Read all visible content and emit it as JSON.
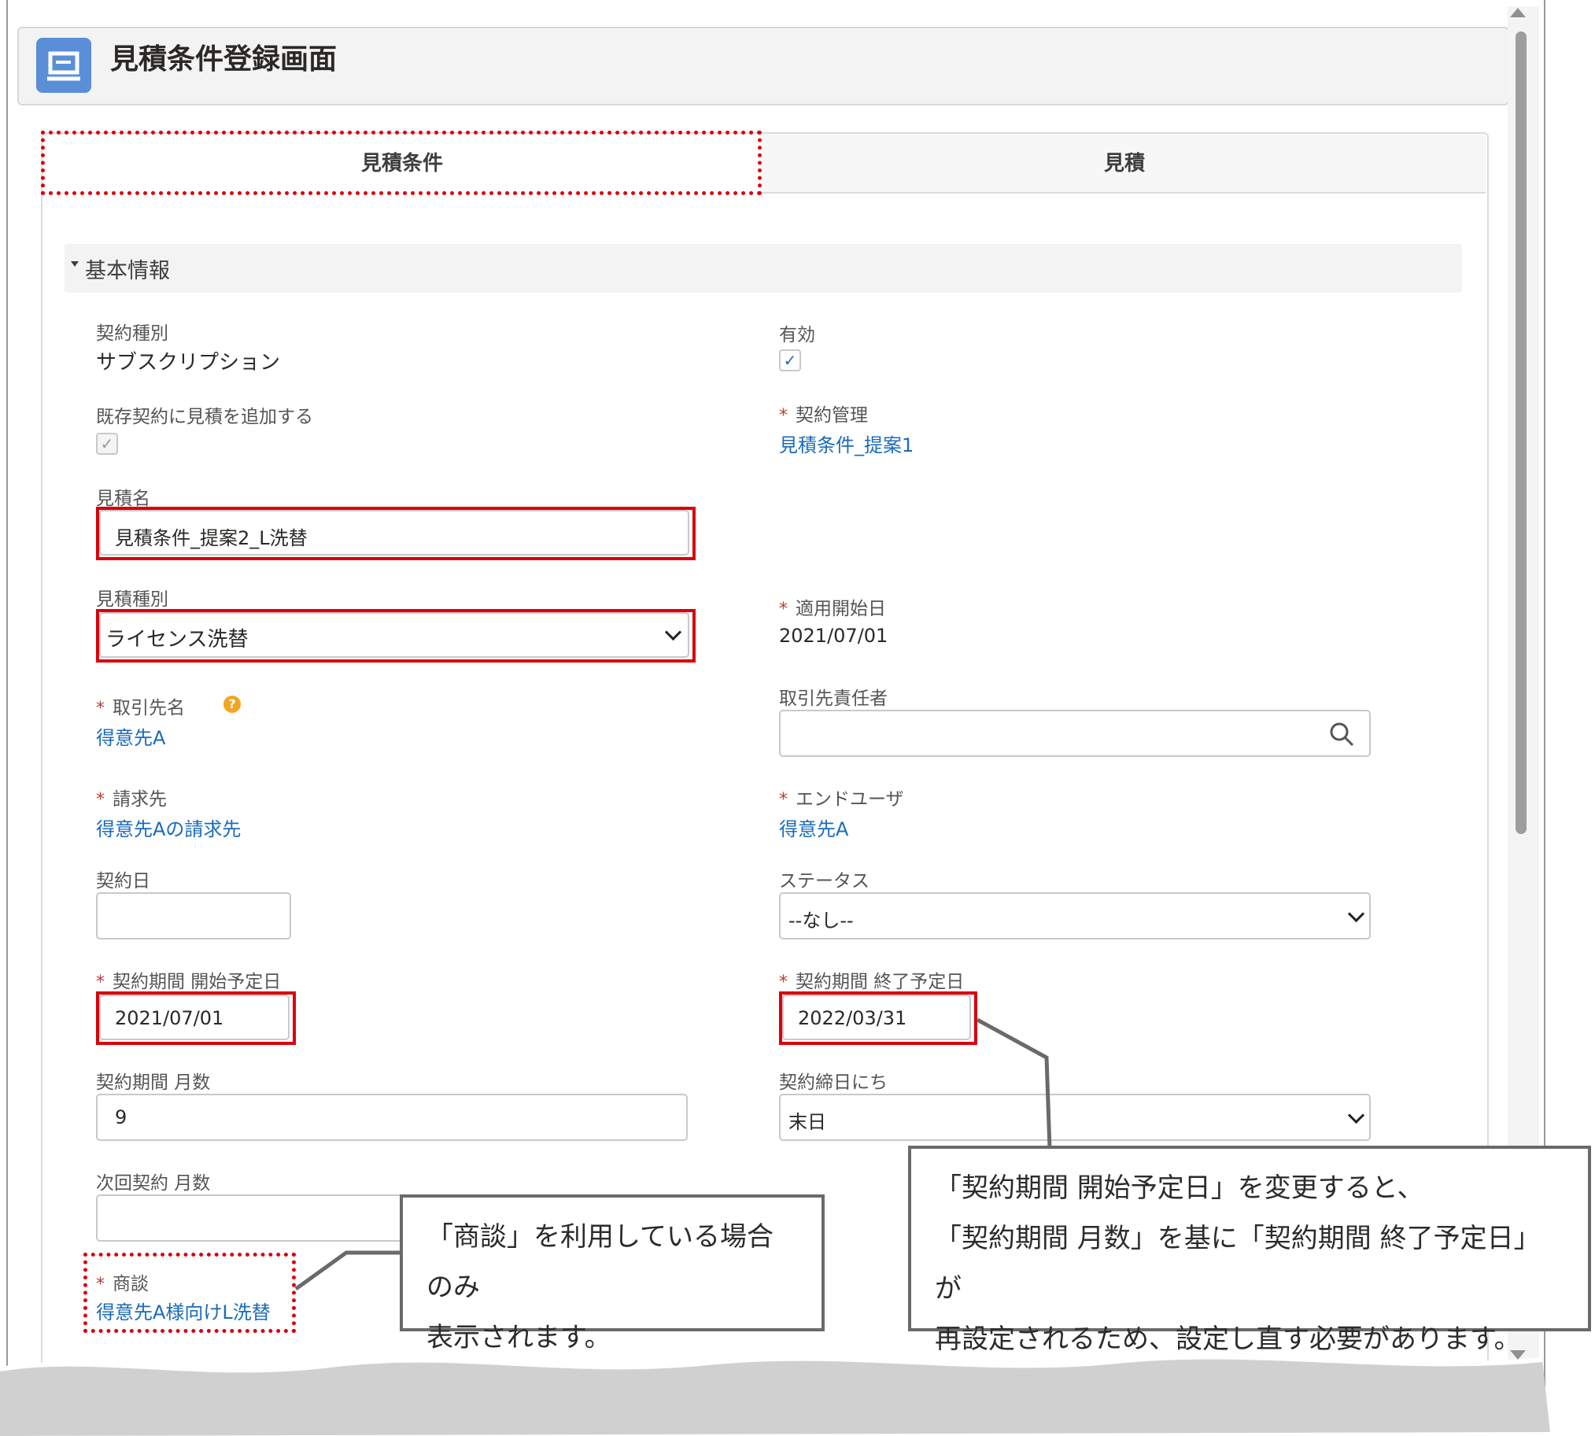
{
  "header": {
    "title": "見積条件登録画面",
    "icon": "record-icon"
  },
  "tabs": [
    {
      "label": "見積条件",
      "selected": true
    },
    {
      "label": "見積",
      "selected": false
    }
  ],
  "section": {
    "title": "基本情報"
  },
  "fields": {
    "contract_type": {
      "label": "契約種別",
      "value": "サブスクリプション"
    },
    "active": {
      "label": "有効",
      "checked": true
    },
    "add_to_existing": {
      "label": "既存契約に見積を追加する",
      "checked": true
    },
    "contract_mgmt": {
      "label": "契約管理",
      "value": "見積条件_提案1"
    },
    "quote_name": {
      "label": "見積名",
      "value": "見積条件_提案2_L洗替"
    },
    "quote_type": {
      "label": "見積種別",
      "value": "ライセンス洗替"
    },
    "apply_start": {
      "label": "適用開始日",
      "value": "2021/07/01"
    },
    "account": {
      "label": "取引先名",
      "value": "得意先A"
    },
    "contact": {
      "label": "取引先責任者",
      "value": ""
    },
    "bill_to": {
      "label": "請求先",
      "value": "得意先Aの請求先"
    },
    "end_user": {
      "label": "エンドユーザ",
      "value": "得意先A"
    },
    "contract_date": {
      "label": "契約日",
      "value": ""
    },
    "status": {
      "label": "ステータス",
      "value": "--なし--"
    },
    "term_start": {
      "label": "契約期間 開始予定日",
      "value": "2021/07/01"
    },
    "term_end": {
      "label": "契約期間 終了予定日",
      "value": "2022/03/31"
    },
    "term_months": {
      "label": "契約期間 月数",
      "value": "9"
    },
    "closing_day": {
      "label": "契約締日にち",
      "value": "末日"
    },
    "next_term_months": {
      "label": "次回契約 月数",
      "value": ""
    },
    "opportunity": {
      "label": "商談",
      "value": "得意先A様向けL洗替"
    }
  },
  "callouts": {
    "opportunity_note": [
      "「商談」を利用している場合のみ",
      "表示されます。"
    ],
    "term_note": [
      "「契約期間 開始予定日」を変更すると、",
      "「契約期間 月数」を基に「契約期間 終了予定日」が",
      "再設定されるため、設定し直す必要があります。"
    ]
  },
  "colors": {
    "link": "#1a6bbc",
    "highlight": "#d9000d",
    "header_icon": "#5a8fd8"
  }
}
